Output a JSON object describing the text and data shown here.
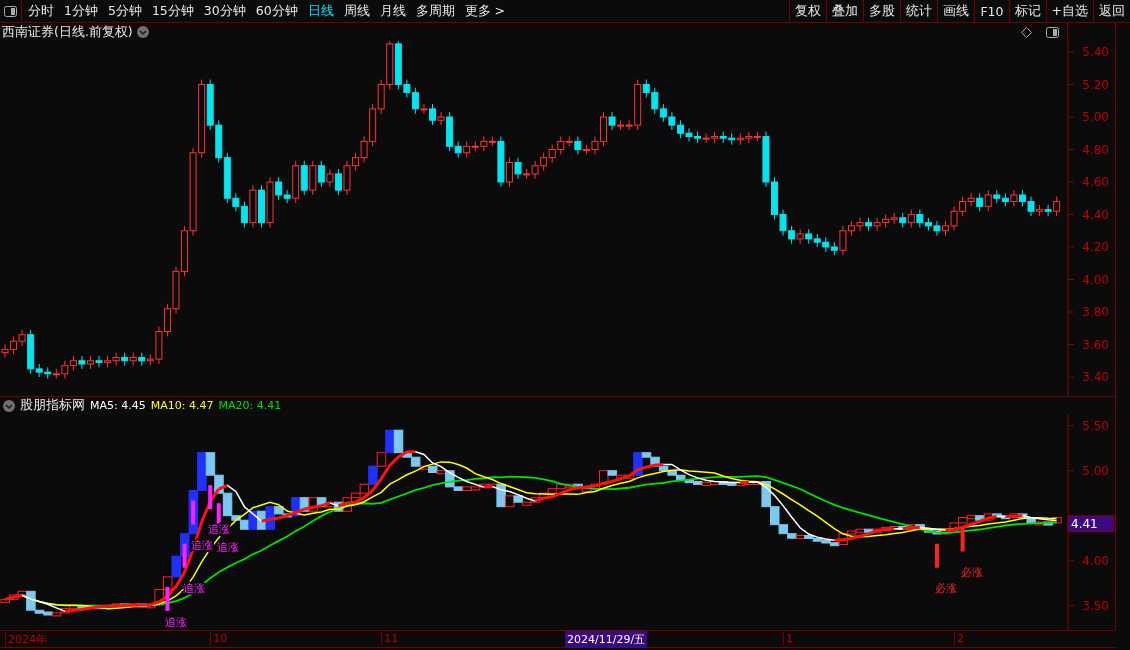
{
  "toolbar": {
    "periods": [
      {
        "label": "分时",
        "selected": false
      },
      {
        "label": "1分钟",
        "selected": false
      },
      {
        "label": "5分钟",
        "selected": false
      },
      {
        "label": "15分钟",
        "selected": false
      },
      {
        "label": "30分钟",
        "selected": false
      },
      {
        "label": "60分钟",
        "selected": false
      },
      {
        "label": "日线",
        "selected": true
      },
      {
        "label": "周线",
        "selected": false
      },
      {
        "label": "月线",
        "selected": false
      },
      {
        "label": "多周期",
        "selected": false
      },
      {
        "label": "更多 >",
        "selected": false
      }
    ],
    "buttons": [
      "复权",
      "叠加",
      "多股",
      "统计",
      "画线",
      "F10",
      "标记",
      "+自选",
      "返回"
    ]
  },
  "price_panel": {
    "title": "西南证券(日线.前复权)",
    "axis_labels": [
      "5.40",
      "5.20",
      "5.00",
      "4.80",
      "4.60",
      "4.40",
      "4.20",
      "4.00",
      "3.80",
      "3.60",
      "3.40"
    ]
  },
  "indicator_panel": {
    "name": "股朋指标网",
    "legend": [
      {
        "label": "MA5: 4.45",
        "color": "#ffffff"
      },
      {
        "label": "MA10: 4.47",
        "color": "#ffff00"
      },
      {
        "label": "MA20: 4.41",
        "color": "#00e000"
      }
    ],
    "current_value": "4.41",
    "axis_labels": [
      "5.50",
      "5.00",
      "4.00",
      "3.50"
    ],
    "signals": [
      {
        "text": "追涨",
        "color": "#ff20ff"
      },
      {
        "text": "追涨",
        "color": "#ff20ff"
      },
      {
        "text": "追涨",
        "color": "#ff20ff"
      },
      {
        "text": "追涨",
        "color": "#ff20ff"
      },
      {
        "text": "追涨",
        "color": "#ff20ff"
      },
      {
        "text": "必涨",
        "color": "#ff2020"
      },
      {
        "text": "必涨",
        "color": "#ff2020"
      }
    ]
  },
  "time_axis": {
    "labels": [
      "2024年",
      "10",
      "11",
      "1",
      "2"
    ],
    "cursor_label": "2024/11/29/五"
  }
}
